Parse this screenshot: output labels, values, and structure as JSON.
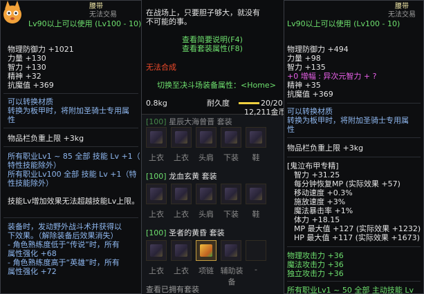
{
  "left": {
    "mascot_label": "Lv90以上可以使用 (Lv100 - 10)",
    "header_right1": "腰带",
    "header_right2": "无法交易",
    "stats": [
      "物理防御力 +1021",
      "力量 +130",
      "智力 +130",
      "精神 +32",
      "抗魔值 +369"
    ],
    "convert1": "可以转换材质",
    "convert2": "转换为板甲时，将附加圣骑士专用属",
    "convert3": "性",
    "weight": "物品栏负重上限 +3kg",
    "skills": [
      "所有职业Lv1 ~ 85 全部 技能 Lv +1（",
      "特性技能除外）",
      "所有职业Lv100 全部 技能 Lv +1（特",
      "性技能除外）"
    ],
    "skill_limit": "技能Lv增加效果无法超越技能Lv上限。",
    "equip": [
      "装备时，发动野外战斗术并获得以",
      "下效果。（解除装备后效果消失）",
      "- 角色熟练度低于“传说”时，所有",
      "属性强化 +68",
      "- 角色熟练度高于“英雄”时，所有",
      "属性强化 +72"
    ]
  },
  "middle": {
    "tip_line1": "在战场上，只要胆子够大，就没有",
    "tip_line2": "不可能的事。",
    "link1": "查看简要说明(F4)",
    "link2": "查看套装属性(F8)",
    "no_synth": "无法合成",
    "switch": "切换至决斗场装备属性：<Home>",
    "weight": "0.8kg",
    "durability_label": "耐久度",
    "durability_value": "20/20",
    "price": "12,211金币",
    "sets": [
      {
        "num": "[100]",
        "name": "星辰大海曾晋 套装",
        "labels": [
          "上衣",
          "上衣",
          "头肩",
          "下装",
          "鞋"
        ]
      },
      {
        "num": "[100]",
        "name": "龙血玄黄 套装",
        "labels": [
          "上衣",
          "上衣",
          "头肩",
          "下装",
          "鞋"
        ]
      },
      {
        "num": "[100]",
        "name": "圣者的黄昏 套装",
        "labels": [
          "上衣",
          "上衣",
          "项链",
          "辅助装备",
          "-"
        ]
      }
    ],
    "view_owned": "查看已拥有套装"
  },
  "right": {
    "header1": "腰带",
    "header2": "无法交易",
    "req": "Lv90以上可以使用 (Lv100 - 10)",
    "stats": [
      "物理防御力 +494",
      "力量 +98",
      "智力 +135"
    ],
    "amp": "+0 增幅 : 异次元智力 + ?",
    "stats2": [
      "精神 +35",
      "抗魔值 +369"
    ],
    "convert1": "可以转换材质",
    "convert2": "转换为板甲时，将附加圣骑士专用属",
    "convert3": "性",
    "weight": "物品栏负重上限 +3kg",
    "special_title": "[鬼泣布甲专精]",
    "special": [
      "智力 +31.25",
      "每分钟恢复MP (实际效果 +57)",
      "移动速度 +0.3%",
      "施放速度 +3%",
      "魔法暴击率 +1%",
      "体力 +18.15",
      "MP 最大值 +127 (实际效果 +1232)",
      "HP 最大值 +117 (实际效果 +1673)"
    ],
    "attack": [
      "物理攻击力 +36",
      "魔法攻击力 +36",
      "独立攻击力 +36"
    ],
    "all_skill": "所有职业Lv1 ~ 50 全部 主动技能 Lv"
  }
}
